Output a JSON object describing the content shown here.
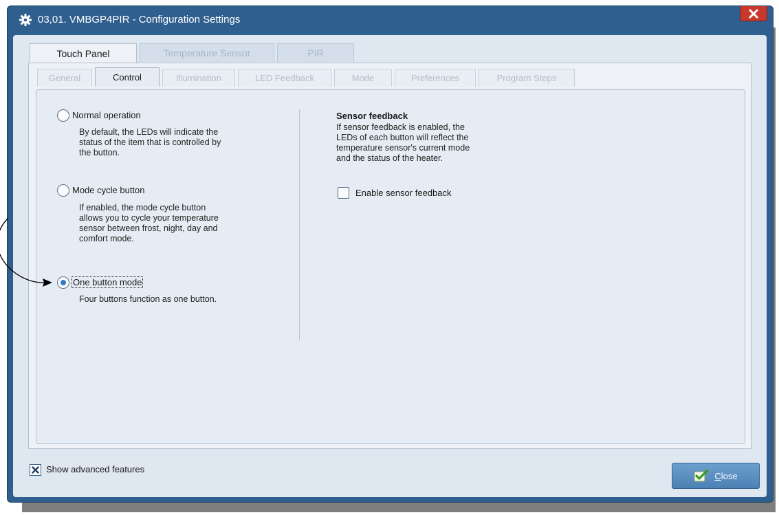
{
  "window": {
    "title": "03,01. VMBGP4PIR - Configuration Settings",
    "title_icon": "gear-icon",
    "close_icon": "close-icon"
  },
  "outer_tabs": [
    {
      "label": "Touch Panel",
      "active": true
    },
    {
      "label": "Temperature Sensor",
      "active": false
    },
    {
      "label": "PIR",
      "active": false
    }
  ],
  "inner_tabs": [
    {
      "label": "General",
      "active": false
    },
    {
      "label": "Control",
      "active": true
    },
    {
      "label": "Illumination",
      "active": false
    },
    {
      "label": "LED Feedback",
      "active": false
    },
    {
      "label": "Mode",
      "active": false
    },
    {
      "label": "Preferences",
      "active": false
    },
    {
      "label": "Program Steps",
      "active": false
    }
  ],
  "options": [
    {
      "label": "Normal operation",
      "checked": false,
      "desc": [
        "By default, the LEDs will indicate the",
        "status of the item that is controlled by",
        "the button."
      ]
    },
    {
      "label": "Mode cycle button",
      "checked": false,
      "desc": [
        "If enabled, the mode cycle button",
        "allows you to cycle your temperature",
        "sensor between frost, night, day and",
        "comfort mode."
      ]
    },
    {
      "label": "One button mode",
      "checked": true,
      "desc": [
        "Four buttons function as one button."
      ]
    }
  ],
  "sensor_feedback": {
    "heading": "Sensor feedback",
    "desc": [
      "If sensor feedback is enabled, the",
      "LEDs of each button will reflect the",
      "temperature sensor's current mode",
      "and the status of the heater."
    ],
    "checkbox_label": "Enable sensor feedback",
    "checked": false
  },
  "footer": {
    "advanced_label": "Show advanced features",
    "advanced_checked": true,
    "close_label_mnemonic": "C",
    "close_label_rest": "lose",
    "close_icon": "checkmark-icon"
  },
  "colors": {
    "titlebar": "#2f5f8e",
    "client": "#dfe7f0",
    "accent": "#3578c6",
    "close_red": "#c8392d"
  }
}
